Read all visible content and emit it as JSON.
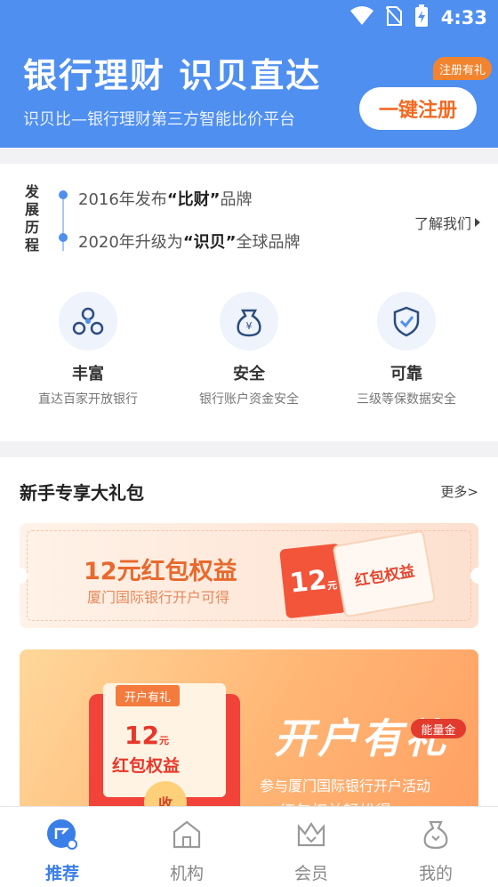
{
  "status_bar": {
    "time": "4:33",
    "icons": [
      "wifi-icon",
      "no-sim-icon",
      "battery-charging-icon"
    ]
  },
  "header": {
    "title": "银行理财 识贝直达",
    "subtitle": "识贝比—银行理财第三方智能比价平台",
    "register_button": "一键注册",
    "register_badge": "注册有礼",
    "bg_color": "#4f8ff0"
  },
  "history": {
    "label": "发展历程",
    "items": [
      {
        "prefix": "2016年发布",
        "highlight": "“比财”",
        "suffix": "品牌"
      },
      {
        "prefix": "2020年升级为",
        "highlight": "“识贝”",
        "suffix": "全球品牌"
      }
    ],
    "about_link": "了解我们"
  },
  "features": [
    {
      "icon": "network-icon",
      "title": "丰富",
      "desc": "直达百家开放银行"
    },
    {
      "icon": "money-bag-icon",
      "title": "安全",
      "desc": "银行账户资金安全"
    },
    {
      "icon": "shield-check-icon",
      "title": "可靠",
      "desc": "三级等保数据安全"
    }
  ],
  "gift_section": {
    "title": "新手专享大礼包",
    "more": "更多>",
    "coupon": {
      "title": "12元红包权益",
      "subtitle": "厦门国际银行开户可得",
      "ticket_amount": "12",
      "ticket_unit": "元",
      "ticket_label": "红包权益"
    },
    "banner": {
      "tag": "开户有礼",
      "amount": "12",
      "amount_unit": "元",
      "amount_label": "红包权益",
      "seal": "收",
      "title": "开户有礼",
      "badge": "能量金",
      "subtitle": "参与厦门国际银行开户活动",
      "subtitle2": "红包权益轻松得"
    }
  },
  "tabs": [
    {
      "label": "推荐",
      "icon": "recommend-icon",
      "active": true
    },
    {
      "label": "机构",
      "icon": "institution-icon",
      "active": false
    },
    {
      "label": "会员",
      "icon": "member-crown-icon",
      "active": false
    },
    {
      "label": "我的",
      "icon": "my-bag-icon",
      "active": false
    }
  ],
  "accent_color": "#3a7ee8",
  "orange_color": "#f26a22"
}
